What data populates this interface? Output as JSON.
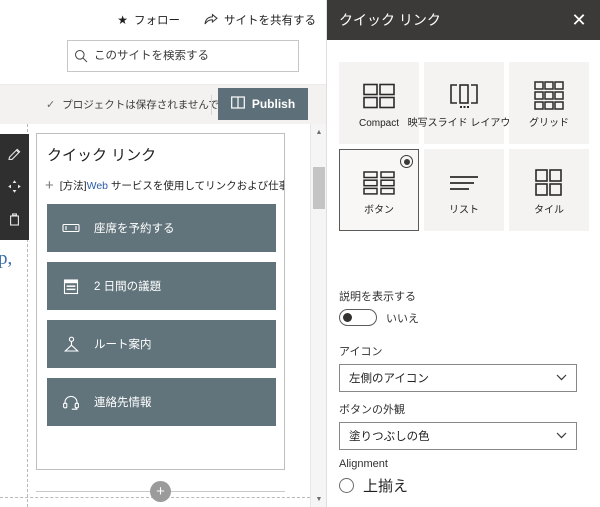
{
  "canvas": {
    "top_actions": [
      {
        "icon": "star-icon",
        "label": "フォロー"
      },
      {
        "icon": "share-icon",
        "label": "サイトを共有する"
      }
    ],
    "search": {
      "placeholder": "このサイトを検索する",
      "value": "",
      "icon": "search-icon"
    },
    "command_bar": {
      "save_status": "プロジェクトは保存されませんでした。",
      "save_status_icon": "check-icon",
      "publish_label": "Publish",
      "publish_icon": "book-icon"
    },
    "mini_toolbar": [
      {
        "icon": "pencil-icon",
        "name": "edit-webpart"
      },
      {
        "icon": "move-icon",
        "name": "move-webpart"
      },
      {
        "icon": "trash-icon",
        "name": "delete-webpart"
      }
    ],
    "webpart": {
      "title": "クイック リンク",
      "add_link_prefix": "[方法]",
      "add_link_highlight": "Web",
      "add_link_rest": " サービスを使用してリンクおよび仕事仲間を追加する",
      "add_icon": "plus-icon",
      "links": [
        {
          "label": "座席を予約する",
          "icon": "ticket-icon"
        },
        {
          "label": "2 日間の議題",
          "icon": "calendar-icon"
        },
        {
          "label": "ルート案内",
          "icon": "directions-icon"
        },
        {
          "label": "連絡先情報",
          "icon": "headset-icon"
        }
      ],
      "tile_color": "#61737b"
    },
    "add_section": {
      "icon": "plus-circle-icon"
    },
    "scrollbar": {
      "up_icon": "caret-up-icon",
      "down_icon": "caret-down-icon"
    }
  },
  "panel": {
    "title": "クイック リンク",
    "close_icon": "close-icon",
    "header_color": "#3b3a39",
    "layouts": [
      {
        "label": "Compact",
        "icon": "compact-layout-icon",
        "selected": false
      },
      {
        "label": "映写スライド レイアウト",
        "icon": "filmstrip-layout-icon",
        "selected": false
      },
      {
        "label": "グリッド",
        "icon": "grid-layout-icon",
        "selected": false
      },
      {
        "label": "ボタン",
        "icon": "button-layout-icon",
        "selected": true
      },
      {
        "label": "リスト",
        "icon": "list-layout-icon",
        "selected": false
      },
      {
        "label": "タイル",
        "icon": "tile-layout-icon",
        "selected": false
      }
    ],
    "show_description": {
      "label": "説明を表示する",
      "value": "いいえ",
      "on": false
    },
    "icon_field": {
      "label": "アイコン",
      "value": "左側のアイコン",
      "chevron": "chevron-down-icon"
    },
    "button_look_field": {
      "label": "ボタンの外観",
      "value": "塗りつぶしの色",
      "chevron": "chevron-down-icon"
    },
    "alignment": {
      "label": "Alignment",
      "option_label": "上揃え",
      "selected": false
    }
  }
}
